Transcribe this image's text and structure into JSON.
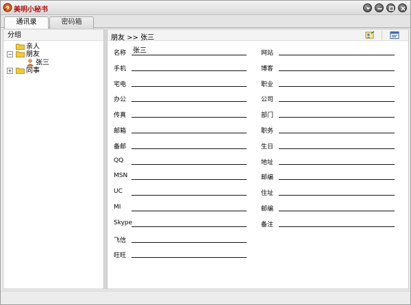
{
  "app": {
    "title": "美明小秘书"
  },
  "tabs": [
    {
      "label": "通讯录",
      "active": true
    },
    {
      "label": "密码箱",
      "active": false
    }
  ],
  "sidebar": {
    "header": "分组",
    "tree": [
      {
        "label": "亲人",
        "type": "folder",
        "expanded": false
      },
      {
        "label": "朋友",
        "type": "folder",
        "expanded": true
      },
      {
        "label": "张三",
        "type": "contact"
      },
      {
        "label": "同事",
        "type": "folder",
        "expanded": false
      }
    ]
  },
  "main": {
    "breadcrumb": "朋友 >> 张三",
    "left_fields": [
      {
        "label": "名称",
        "value": "张三"
      },
      {
        "label": "手机",
        "value": ""
      },
      {
        "label": "宅电",
        "value": ""
      },
      {
        "label": "办公",
        "value": ""
      },
      {
        "label": "传真",
        "value": ""
      },
      {
        "label": "邮箱",
        "value": ""
      },
      {
        "label": "备邮",
        "value": ""
      },
      {
        "label": "QQ",
        "value": ""
      },
      {
        "label": "MSN",
        "value": ""
      },
      {
        "label": "UC",
        "value": ""
      },
      {
        "label": "MI",
        "value": ""
      },
      {
        "label": "Skype",
        "value": ""
      },
      {
        "label": "飞信",
        "value": ""
      },
      {
        "label": "旺旺",
        "value": ""
      }
    ],
    "right_fields": [
      {
        "label": "网站",
        "value": ""
      },
      {
        "label": "博客",
        "value": ""
      },
      {
        "label": "职业",
        "value": ""
      },
      {
        "label": "公司",
        "value": ""
      },
      {
        "label": "部门",
        "value": ""
      },
      {
        "label": "职务",
        "value": ""
      },
      {
        "label": "生日",
        "value": ""
      },
      {
        "label": "地址",
        "value": ""
      },
      {
        "label": "邮编",
        "value": ""
      },
      {
        "label": "住址",
        "value": ""
      },
      {
        "label": "邮编",
        "value": ""
      },
      {
        "label": "备注",
        "value": ""
      }
    ]
  },
  "colors": {
    "title_text": "#b01010",
    "folder": "#f0c93c",
    "window_bg": "#ececec"
  },
  "icons": [
    "app-logo-icon",
    "menu-icon",
    "minimize-icon",
    "maximize-icon",
    "close-icon",
    "folder-icon",
    "contact-icon",
    "edit-contact-icon",
    "card-view-icon"
  ]
}
